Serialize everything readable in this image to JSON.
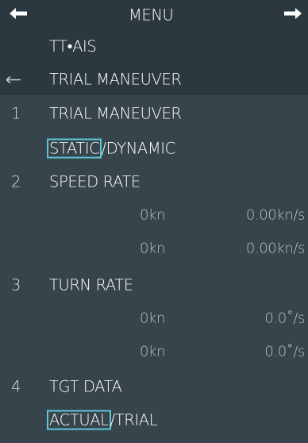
{
  "header": {
    "title": "MENU",
    "left_icon": "arrow-left-icon",
    "right_icon": "arrow-right-icon"
  },
  "breadcrumb": {
    "parent": "TT•AIS",
    "current": "TRIAL MANEUVER",
    "back_icon": "back-arrow-icon"
  },
  "items": {
    "i1": {
      "num": "1",
      "label": "TRIAL MANEUVER",
      "opt_a": "STATIC",
      "sep": "/",
      "opt_b": "DYNAMIC"
    },
    "i2": {
      "num": "2",
      "label": "SPEED RATE",
      "r1_a": "0kn",
      "r1_b": "0.00kn/s",
      "r2_a": "0kn",
      "r2_b": "0.00kn/s"
    },
    "i3": {
      "num": "3",
      "label": "TURN RATE",
      "r1_a": "0kn",
      "r1_b": "0.0˚/s",
      "r2_a": "0kn",
      "r2_b": "0.0˚/s"
    },
    "i4": {
      "num": "4",
      "label": "TGT DATA",
      "opt_a": "ACTUAL",
      "sep": "/",
      "opt_b": "TRIAL"
    }
  },
  "colors": {
    "panel": "#37444c",
    "band": "#2c383f",
    "selection": "#5bc6d6"
  }
}
